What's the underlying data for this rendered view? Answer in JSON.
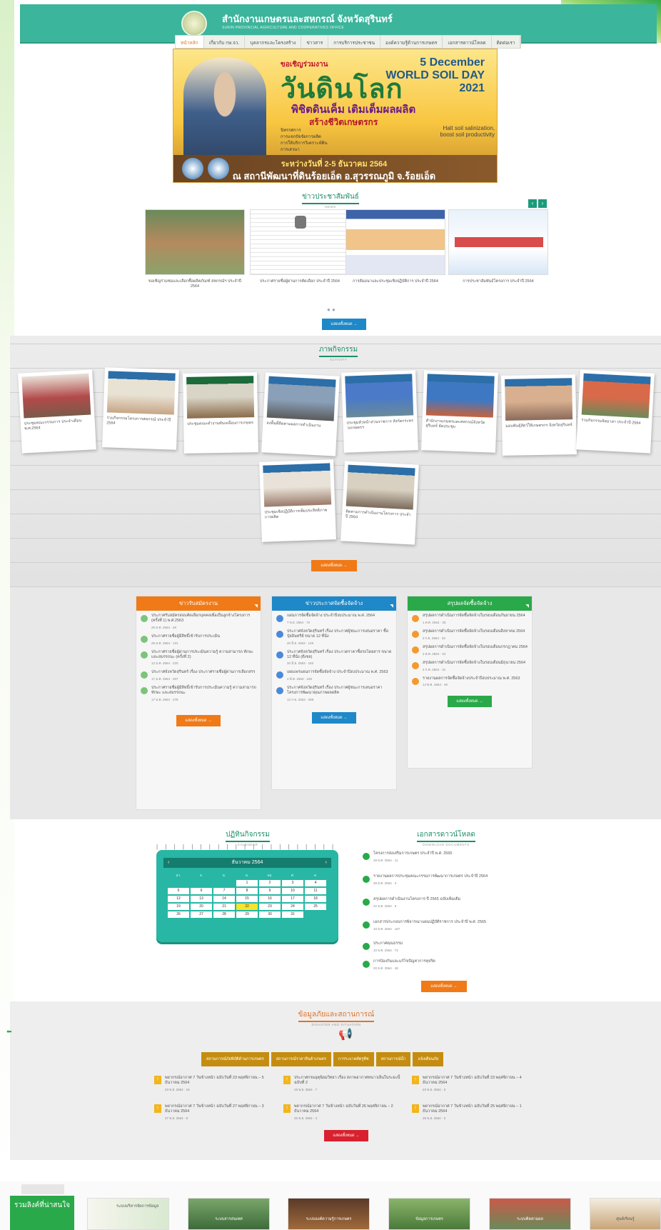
{
  "header": {
    "site_title": "สำนักงานเกษตรและสหกรณ์ จังหวัดสุรินทร์",
    "site_subtitle": "SURIN PROVINCIAL AGRICULTURE AND COOPERATIVES OFFICE"
  },
  "nav": {
    "items": [
      "หน้าหลัก",
      "เกี่ยวกับ กษ.จว.",
      "บุคลากรและโครงสร้าง",
      "ข่าวสาร",
      "การบริการประชาชน",
      "องค์ความรู้ด้านการเกษตร",
      "เอกสารดาวน์โหลด",
      "ติดต่อเรา"
    ]
  },
  "banner": {
    "invite": "ขอเชิญร่วมงาน",
    "title": "วันดินโลก",
    "line1": "พิชิตดินเค็ม เติมเต็มผลผลิต",
    "line2": "สร้างชีวิตเกษตรกร",
    "date_en": "5 December WORLD SOIL DAY 2021",
    "slogan_en": "Halt soil salinization, boost soil productivity",
    "activities": [
      "นิทรรศการ",
      "การแจกปัจจัยการผลิต",
      "การให้บริการวิเคราะห์ดิน",
      "การเสวนา"
    ],
    "day_text": "ระหว่างวันที่ 2-5 ธันวาคม 2564",
    "location": "ณ สถานีพัฒนาที่ดินร้อยเอ็ด อ.สุวรรณภูมิ จ.ร้อยเอ็ด"
  },
  "news": {
    "heading": "ข่าวประชาสัมพันธ์",
    "heading_en": "NEWS",
    "items": [
      {
        "caption": "ขอเชิญร่วมชมและเลือกซื้อผลิตภัณฑ์ สหกรณ์ฯ ประจำปี 2564"
      },
      {
        "caption": "ประกาศรายชื่อผู้ผ่านการคัดเลือก ประจำปี 2564"
      },
      {
        "caption": "การสัมมนาและประชุมเชิงปฏิบัติการ ประจำปี 2564"
      },
      {
        "caption": "การประชาสัมพันธ์โครงการ ประจำปี 2564"
      }
    ],
    "more": "แสดงทั้งหมด →"
  },
  "activity": {
    "heading": "ภาพกิจกรรม",
    "heading_en": "ACTIVITY",
    "items": [
      {
        "caption": "ประชุมคณะกรรมการ ประจำเดือน พ.ศ.2564"
      },
      {
        "caption": "ร่วมกิจกรรมโครงการสหกรณ์ ประจำปี 2564"
      },
      {
        "caption": "ประชุมคณะทำงานขับเคลื่อนการเกษตร"
      },
      {
        "caption": "ลงพื้นที่ติดตามผลการดำเนินงาน"
      },
      {
        "caption": "ประชุมหัวหน้าส่วนราชการ สังกัดกระทรวงเกษตรฯ"
      },
      {
        "caption": "สำนักงานเกษตรและสหกรณ์จังหวัดสุรินทร์ จัดประชุม"
      },
      {
        "caption": "มอบพันธุ์สัตว์ให้เกษตรกร จังหวัดสุรินทร์"
      },
      {
        "caption": "ร่วมกิจกรรมจิตอาสา ประจำปี 2564"
      },
      {
        "caption": "ประชุมเชิงปฏิบัติการเพิ่มประสิทธิภาพการผลิต"
      },
      {
        "caption": "ติดตามการดำเนินงานโครงการ ประจำปี 2564"
      }
    ],
    "more": "แสดงทั้งหมด →"
  },
  "columns": {
    "job": {
      "title": "ข่าวรับสมัครงาน",
      "items": [
        {
          "text": "ประกาศรับสมัครสอบคัดเลือกบุคคลเพื่อเป็นลูกจ้างโครงการ (ครั้งที่ 1) พ.ศ.2563",
          "date": "29 ม.ค. 2564",
          "views": "48"
        },
        {
          "text": "ประกาศรายชื่อผู้มีสิทธิ์เข้ารับการประเมิน",
          "date": "29 ม.ค. 2564",
          "views": "131"
        },
        {
          "text": "ประกาศรายชื่อผู้ผ่านการประเมินความรู้ ความสามารถ ทักษะ และสมรรถนะ (ครั้งที่ 2)",
          "date": "12 ม.ค. 2564",
          "views": "220"
        },
        {
          "text": "ประกาศจังหวัดสุรินทร์ เรื่อง ประกาศรายชื่อผู้ผ่านการเลือกสรร",
          "date": "17 ม.ค. 2564",
          "views": "207"
        },
        {
          "text": "ประกาศรายชื่อผู้มีสิทธิ์เข้ารับการประเมินความรู้ ความสามารถ ทักษะ และสมรรถนะ",
          "date": "17 ม.ค. 2564",
          "views": "278"
        }
      ],
      "more": "แสดงทั้งหมด →"
    },
    "procure": {
      "title": "ข่าวประกาศจัดซื้อจัดจ้าง",
      "items": [
        {
          "text": "แผนการจัดซื้อจัดจ้าง ประจำปีงบประมาณ พ.ศ. 2564",
          "date": "7 พ.ย. 2564",
          "views": "72"
        },
        {
          "text": "ประกาศจังหวัดสุรินทร์ เรื่อง ประกาศผู้ชนะการเสนอราคา ซื้อปุ๋ยอินทรีย์ ขนาด 12 ที่นั่ง",
          "date": "20 มิ.ย. 2563",
          "views": "149"
        },
        {
          "text": "ประกาศจังหวัดสุรินทร์ เรื่อง ประกวดราคาซื้อรถโดยสาร ขนาด 12 ที่นั่ง (ดีเซล)",
          "date": "20 มิ.ย. 2563",
          "views": "163"
        },
        {
          "text": "เผยแพร่แผนการจัดซื้อจัดจ้าง ประจำปีงบประมาณ พ.ศ. 2563",
          "date": "4 มี.ค. 2563",
          "views": "246"
        },
        {
          "text": "ประกาศจังหวัดสุรินทร์ เรื่อง ประกาศผู้ชนะการเสนอราคา โครงการพัฒนาคุณภาพผลผลิต",
          "date": "12 ก.พ. 2563",
          "views": "289"
        }
      ],
      "more": "แสดงทั้งหมด →"
    },
    "summary": {
      "title": "สรุปผลจัดซื้อจัดจ้าง",
      "items": [
        {
          "text": "สรุปผลการดำเนินการจัดซื้อจัดจ้างในรอบเดือนกันยายน 2564",
          "date": "1 ต.ค. 2564",
          "views": "25"
        },
        {
          "text": "สรุปผลการดำเนินการจัดซื้อจัดจ้างในรอบเดือนสิงหาคม 2564",
          "date": "2 ก.ย. 2564",
          "views": "33"
        },
        {
          "text": "สรุปผลการดำเนินการจัดซื้อจัดจ้างในรอบเดือนกรกฎาคม 2564",
          "date": "2 ส.ค. 2564",
          "views": "23"
        },
        {
          "text": "สรุปผลการดำเนินการจัดซื้อจัดจ้างในรอบเดือนมิถุนายน 2564",
          "date": "2 ก.ค. 2564",
          "views": "31"
        },
        {
          "text": "รายงานผลการจัดซื้อจัดจ้างประจำปีงบประมาณ พ.ศ. 2563",
          "date": "14 ต.ค. 2564",
          "views": "46"
        }
      ],
      "more": "แสดงทั้งหมด →"
    }
  },
  "calendar": {
    "heading": "ปฏิทินกิจกรรม",
    "heading_en": "CALENDAR",
    "month": "ธันวาคม  2564",
    "weekdays": [
      "อา.",
      "จ.",
      "อ.",
      "พ.",
      "พฤ.",
      "ศ.",
      "ส."
    ],
    "days": [
      "",
      "",
      "",
      "1",
      "2",
      "3",
      "4",
      "5",
      "6",
      "7",
      "8",
      "9",
      "10",
      "11",
      "12",
      "13",
      "14",
      "15",
      "16",
      "17",
      "18",
      "19",
      "20",
      "21",
      "22",
      "23",
      "24",
      "25",
      "26",
      "27",
      "28",
      "29",
      "30",
      "31",
      ""
    ],
    "today": "22"
  },
  "documents": {
    "heading": "เอกสารดาวน์โหลด",
    "heading_en": "DOWNLOAD DOCUMENTS",
    "items": [
      {
        "text": "โครงการส่งเสริมการเกษตร ประจำปี พ.ศ. 2565",
        "date": "29 ธ.ค. 2564",
        "views": "11"
      },
      {
        "text": "รายงานผลการประชุมคณะกรรมการพัฒนาการเกษตร ประจำปี 2564",
        "date": "28 ธ.ค. 2564",
        "views": "3"
      },
      {
        "text": "สรุปผลการดำเนินงานโครงการ ปี 2565 ฉบับเพิ่มเติม",
        "date": "22 ธ.ค. 2564",
        "views": "6"
      },
      {
        "text": "เอกสารประกอบการพิจารณาแผนปฏิบัติราชการ ประจำปี พ.ศ. 2565",
        "date": "10 ธ.ค. 2564",
        "views": "167"
      },
      {
        "text": "ประกาศคุณธรรม",
        "date": "10 ธ.ค. 2564",
        "views": "72"
      },
      {
        "text": "การป้องกันและแก้ไขปัญหาการทุจริต",
        "date": "20 ธ.ค. 2564",
        "views": "48"
      }
    ],
    "more": "แสดงทั้งหมด →"
  },
  "situation": {
    "heading": "ข้อมูลภัยและสถานการณ์",
    "heading_en": "DISASTER AND SITUATION",
    "tabs": [
      "สถานการณ์ภัยพิบัติด้านการเกษตร",
      "สถานการณ์ราคาสินค้าเกษตร",
      "การระบาดศัตรูพืช",
      "สถานการณ์น้ำ",
      "แจ้งเตือนภัย"
    ],
    "items": [
      {
        "text": "พยากรณ์อากาศ 7 วันข้างหน้า ฉบับวันที่ 23 พฤศจิกายน – 5 ธันวาคม 2564",
        "date": "23 พ.ย. 2564",
        "views": "15"
      },
      {
        "text": "ประกาศกรมอุตุนิยมวิทยา เรื่อง สภาพอากาศหนาวเย็นในระยะนี้ ฉบับที่ 2",
        "date": "19 พ.ย. 2564",
        "views": "7"
      },
      {
        "text": "พยากรณ์อากาศ 7 วันข้างหน้า ฉบับวันที่ 23 พฤศจิกายน – 4 ธันวาคม 2564",
        "date": "23 พ.ย. 2564",
        "views": "3"
      },
      {
        "text": "พยากรณ์อากาศ 7 วันข้างหน้า ฉบับวันที่ 27 พฤศจิกายน – 3 ธันวาคม 2564",
        "date": "27 พ.ย. 2564",
        "views": "8"
      },
      {
        "text": "พยากรณ์อากาศ 7 วันข้างหน้า ฉบับวันที่ 26 พฤศจิกายน – 2 ธันวาคม 2564",
        "date": "26 พ.ย. 2564",
        "views": "4"
      },
      {
        "text": "พยากรณ์อากาศ 7 วันข้างหน้า ฉบับวันที่ 25 พฤศจิกายน – 1 ธันวาคม 2564",
        "date": "25 พ.ย. 2564",
        "views": "3"
      }
    ],
    "more": "แสดงทั้งหมด →"
  },
  "footer": {
    "head_title": "รวมลิงค์ที่น่าสนใจ",
    "cards": [
      "ระบบบริหารจัดการข้อมูล",
      "ระบบสารสนเทศ",
      "ระบบองค์ความรู้การเกษตร",
      "ข้อมูลการเกษตร",
      "ระบบติดตามผล",
      "ศูนย์เรียนรู้"
    ]
  },
  "colors": {
    "brand_teal": "#3bb59b",
    "job_orange": "#f07a17",
    "procure_blue": "#1e88c8",
    "summary_green": "#2aa94a",
    "tab_gold": "#c58d10"
  }
}
